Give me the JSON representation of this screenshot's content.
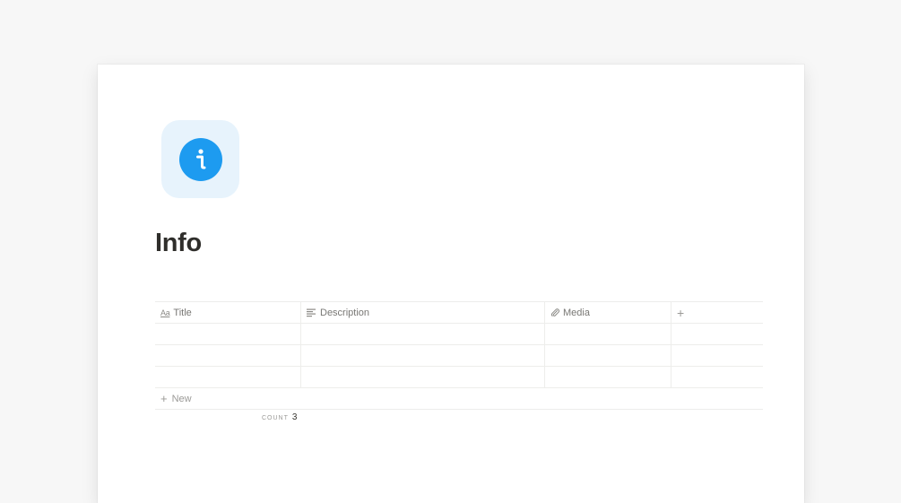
{
  "page": {
    "title": "Info",
    "icon": "info-icon",
    "icon_bg_color": "#e7f3fc",
    "icon_color": "#1d9bf0"
  },
  "database": {
    "columns": [
      {
        "label": "Title",
        "icon": "text-aa-icon"
      },
      {
        "label": "Description",
        "icon": "text-lines-icon"
      },
      {
        "label": "Media",
        "icon": "paperclip-icon"
      }
    ],
    "add_column_symbol": "+",
    "rows": [
      {
        "title": "",
        "description": "",
        "media": ""
      },
      {
        "title": "",
        "description": "",
        "media": ""
      },
      {
        "title": "",
        "description": "",
        "media": ""
      }
    ],
    "new_label": "New",
    "new_symbol": "+",
    "footer": {
      "count_label": "COUNT",
      "count_value": "3"
    }
  }
}
